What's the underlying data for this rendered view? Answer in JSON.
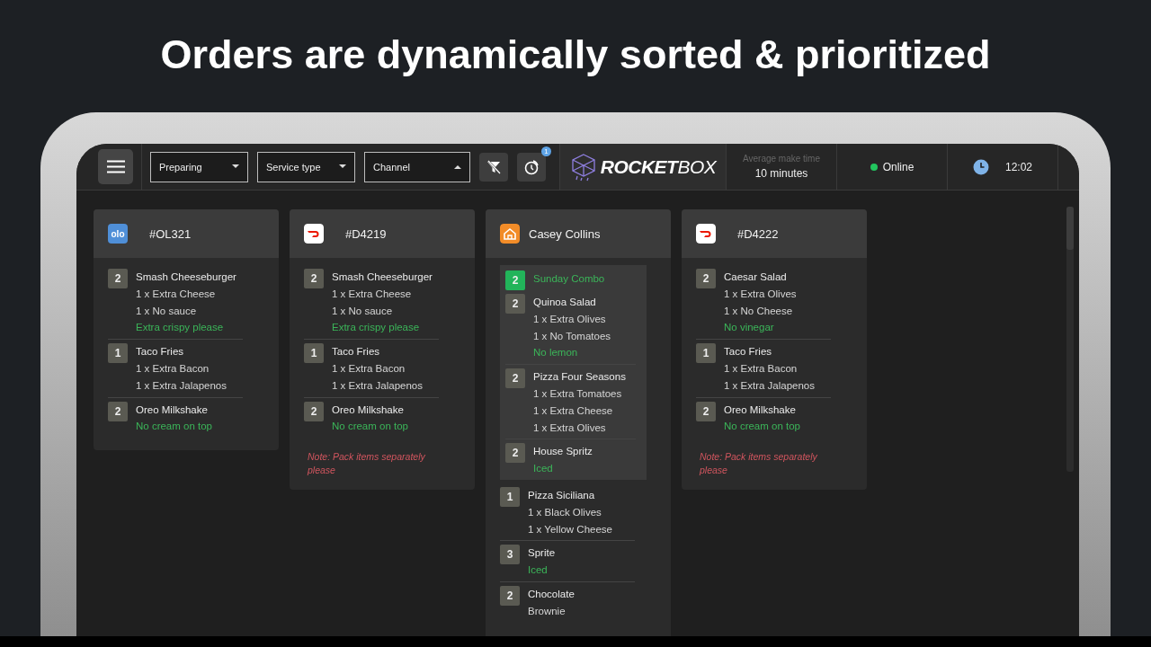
{
  "headline": "Orders are dynamically sorted & prioritized",
  "toolbar": {
    "filters": [
      {
        "value": "Preparing",
        "expanded": false
      },
      {
        "value": "Service type",
        "expanded": false
      },
      {
        "value": "Channel",
        "expanded": true
      }
    ],
    "timer_badge": "1",
    "logo": {
      "bold": "ROCKET",
      "light": "BOX"
    },
    "make_time": {
      "label": "Average make time",
      "value": "10 minutes"
    },
    "status": {
      "label": "Online",
      "color": "#22c55e"
    },
    "clock": "12:02"
  },
  "orders": [
    {
      "icon": {
        "kind": "olo",
        "text": "olo"
      },
      "title": "#OL321",
      "items": [
        {
          "kind": "item",
          "qty": "2",
          "name": "Smash Cheeseburger",
          "lines": [
            {
              "kind": "modifier",
              "text": "1 x Extra Cheese"
            },
            {
              "kind": "modifier",
              "text": "1 x No sauce"
            },
            {
              "kind": "note",
              "text": "Extra crispy please"
            }
          ]
        },
        {
          "kind": "item",
          "qty": "1",
          "name": "Taco Fries",
          "lines": [
            {
              "kind": "modifier",
              "text": "1 x Extra Bacon"
            },
            {
              "kind": "modifier",
              "text": "1 x Extra Jalapenos"
            }
          ]
        },
        {
          "kind": "item",
          "qty": "2",
          "name": "Oreo Milkshake",
          "lines": [
            {
              "kind": "note",
              "text": "No cream on top"
            }
          ]
        }
      ]
    },
    {
      "icon": {
        "kind": "swoosh"
      },
      "title": "#D4219",
      "note": "Note: Pack items separately please",
      "items": [
        {
          "kind": "item",
          "qty": "2",
          "name": "Smash Cheeseburger",
          "lines": [
            {
              "kind": "modifier",
              "text": "1 x Extra Cheese"
            },
            {
              "kind": "modifier",
              "text": "1 x No sauce"
            },
            {
              "kind": "note",
              "text": "Extra crispy please"
            }
          ]
        },
        {
          "kind": "item",
          "qty": "1",
          "name": "Taco Fries",
          "lines": [
            {
              "kind": "modifier",
              "text": "1 x Extra Bacon"
            },
            {
              "kind": "modifier",
              "text": "1 x Extra Jalapenos"
            }
          ]
        },
        {
          "kind": "item",
          "qty": "2",
          "name": "Oreo Milkshake",
          "lines": [
            {
              "kind": "note",
              "text": "No cream on top"
            }
          ]
        }
      ]
    },
    {
      "icon": {
        "kind": "house"
      },
      "title": "Casey Collins",
      "items": [
        {
          "kind": "combo",
          "qty": "2",
          "name": "Sunday Combo",
          "items": [
            {
              "kind": "item",
              "qty": "2",
              "name": "Quinoa Salad",
              "lines": [
                {
                  "kind": "modifier",
                  "text": "1 x Extra Olives"
                },
                {
                  "kind": "modifier",
                  "text": "1 x No Tomatoes"
                },
                {
                  "kind": "note",
                  "text": "No lemon"
                }
              ]
            },
            {
              "kind": "item",
              "qty": "2",
              "name": "Pizza Four Seasons",
              "lines": [
                {
                  "kind": "modifier",
                  "text": "1 x Extra Tomatoes"
                },
                {
                  "kind": "modifier",
                  "text": "1 x Extra Cheese"
                },
                {
                  "kind": "modifier",
                  "text": "1 x Extra Olives"
                }
              ]
            },
            {
              "kind": "item",
              "qty": "2",
              "name": "House Spritz",
              "lines": [
                {
                  "kind": "note",
                  "text": "Iced"
                }
              ]
            }
          ]
        },
        {
          "kind": "item",
          "qty": "1",
          "name": "Pizza Siciliana",
          "lines": [
            {
              "kind": "modifier",
              "text": "1 x Black Olives"
            },
            {
              "kind": "modifier",
              "text": "1 x Yellow Cheese"
            }
          ]
        },
        {
          "kind": "item",
          "qty": "3",
          "name": "Sprite",
          "lines": [
            {
              "kind": "note",
              "text": "Iced"
            }
          ]
        },
        {
          "kind": "item",
          "qty": "2",
          "name": "Chocolate",
          "lines": [
            {
              "kind": "modifier",
              "text": "Brownie"
            }
          ]
        }
      ]
    },
    {
      "icon": {
        "kind": "swoosh"
      },
      "title": "#D4222",
      "note": "Note: Pack items separately please",
      "items": [
        {
          "kind": "item",
          "qty": "2",
          "name": "Caesar Salad",
          "lines": [
            {
              "kind": "modifier",
              "text": "1 x Extra Olives"
            },
            {
              "kind": "modifier",
              "text": "1 x No Cheese"
            },
            {
              "kind": "note",
              "text": "No vinegar"
            }
          ]
        },
        {
          "kind": "item",
          "qty": "1",
          "name": "Taco Fries",
          "lines": [
            {
              "kind": "modifier",
              "text": "1 x Extra Bacon"
            },
            {
              "kind": "modifier",
              "text": "1 x Extra Jalapenos"
            }
          ]
        },
        {
          "kind": "item",
          "qty": "2",
          "name": "Oreo Milkshake",
          "lines": [
            {
              "kind": "note",
              "text": "No cream on top"
            }
          ]
        }
      ]
    }
  ]
}
